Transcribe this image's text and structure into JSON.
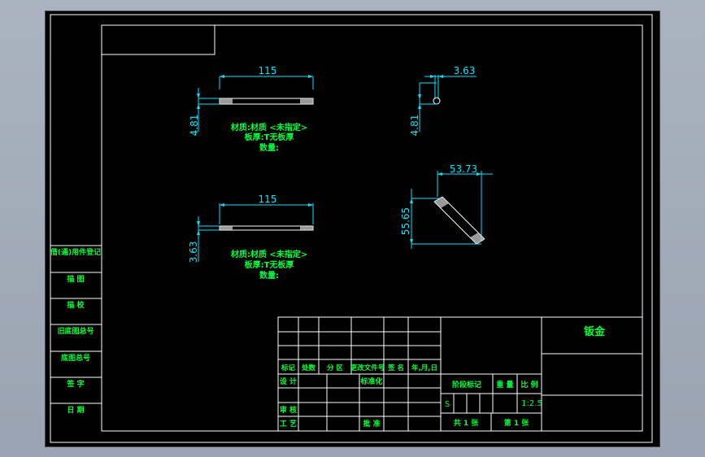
{
  "views": {
    "top_left": {
      "dim_width": "115",
      "dim_thickness": "4.81",
      "notes": [
        "材质:材质 <未指定>",
        "板厚:T无板厚",
        "数量:"
      ]
    },
    "bottom_left": {
      "dim_width": "115",
      "dim_thickness": "3.63",
      "notes": [
        "材质:材质 <未指定>",
        "板厚:T无板厚",
        "数量:"
      ]
    },
    "top_right": {
      "dim_width": "3.63",
      "dim_thickness": "4.81"
    },
    "bottom_right": {
      "dim_width": "53.73",
      "dim_height": "55.65"
    }
  },
  "side_labels": [
    "借(通)用件登记",
    "描 图",
    "描 校",
    "旧底图总号",
    "底图总号",
    "签 字",
    "日 期"
  ],
  "title_block": {
    "headers": [
      "标记",
      "处数",
      "分 区",
      "更改文件号",
      "签 名",
      "年,月,日"
    ],
    "row_design": "设 计",
    "row_standard": "标准化",
    "row_review": "审 核",
    "row_process": "工 艺",
    "row_approve": "批 准",
    "stage_mark": "阶段标记",
    "weight": "重 量",
    "scale_label": "比 例",
    "stage_value": "S",
    "scale_value": "1:2.5",
    "sheets_total": "共 1 张",
    "sheet_no": "第 1 张",
    "part_name": "钣金"
  },
  "colors": {
    "background": "#000000",
    "text": "#00ff3c",
    "dimension": "#00e5ff",
    "border": "#ffffff"
  }
}
